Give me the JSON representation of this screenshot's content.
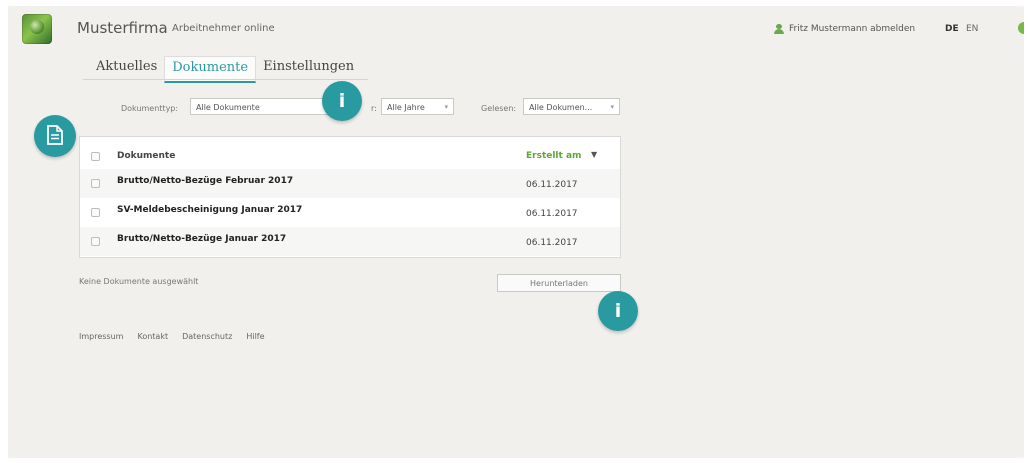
{
  "header": {
    "company": "Musterfirma",
    "subtitle": "Arbeitnehmer online",
    "user_logout": "Fritz Mustermann abmelden",
    "lang_de": "DE",
    "lang_en": "EN"
  },
  "tabs": [
    {
      "label": "Aktuelles",
      "active": false
    },
    {
      "label": "Dokumente",
      "active": true
    },
    {
      "label": "Einstellungen",
      "active": false
    }
  ],
  "filters": {
    "dokumenttyp_label": "Dokumenttyp:",
    "dokumenttyp_value": "Alle Dokumente",
    "jahr_label": "Jahr:",
    "jahr_label_visible": "r:",
    "jahr_value": "Alle Jahre",
    "gelesen_label": "Gelesen:",
    "gelesen_value": "Alle Dokumen..."
  },
  "info_bubble": "i",
  "table": {
    "header_documents": "Dokumente",
    "header_created": "Erstellt am",
    "rows": [
      {
        "name": "Brutto/Netto-Bezüge Februar 2017",
        "date": "06.11.2017"
      },
      {
        "name": "SV-Meldebescheinigung Januar 2017",
        "date": "06.11.2017"
      },
      {
        "name": "Brutto/Netto-Bezüge Januar 2017",
        "date": "06.11.2017"
      }
    ]
  },
  "selection_status": "Keine Dokumente ausgewählt",
  "download_label": "Herunterladen",
  "footer": {
    "impressum": "Impressum",
    "kontakt": "Kontakt",
    "datenschutz": "Datenschutz",
    "hilfe": "Hilfe"
  },
  "colors": {
    "accent": "#2a9aa1",
    "green": "#5fa536",
    "background": "#f1f0ec"
  }
}
